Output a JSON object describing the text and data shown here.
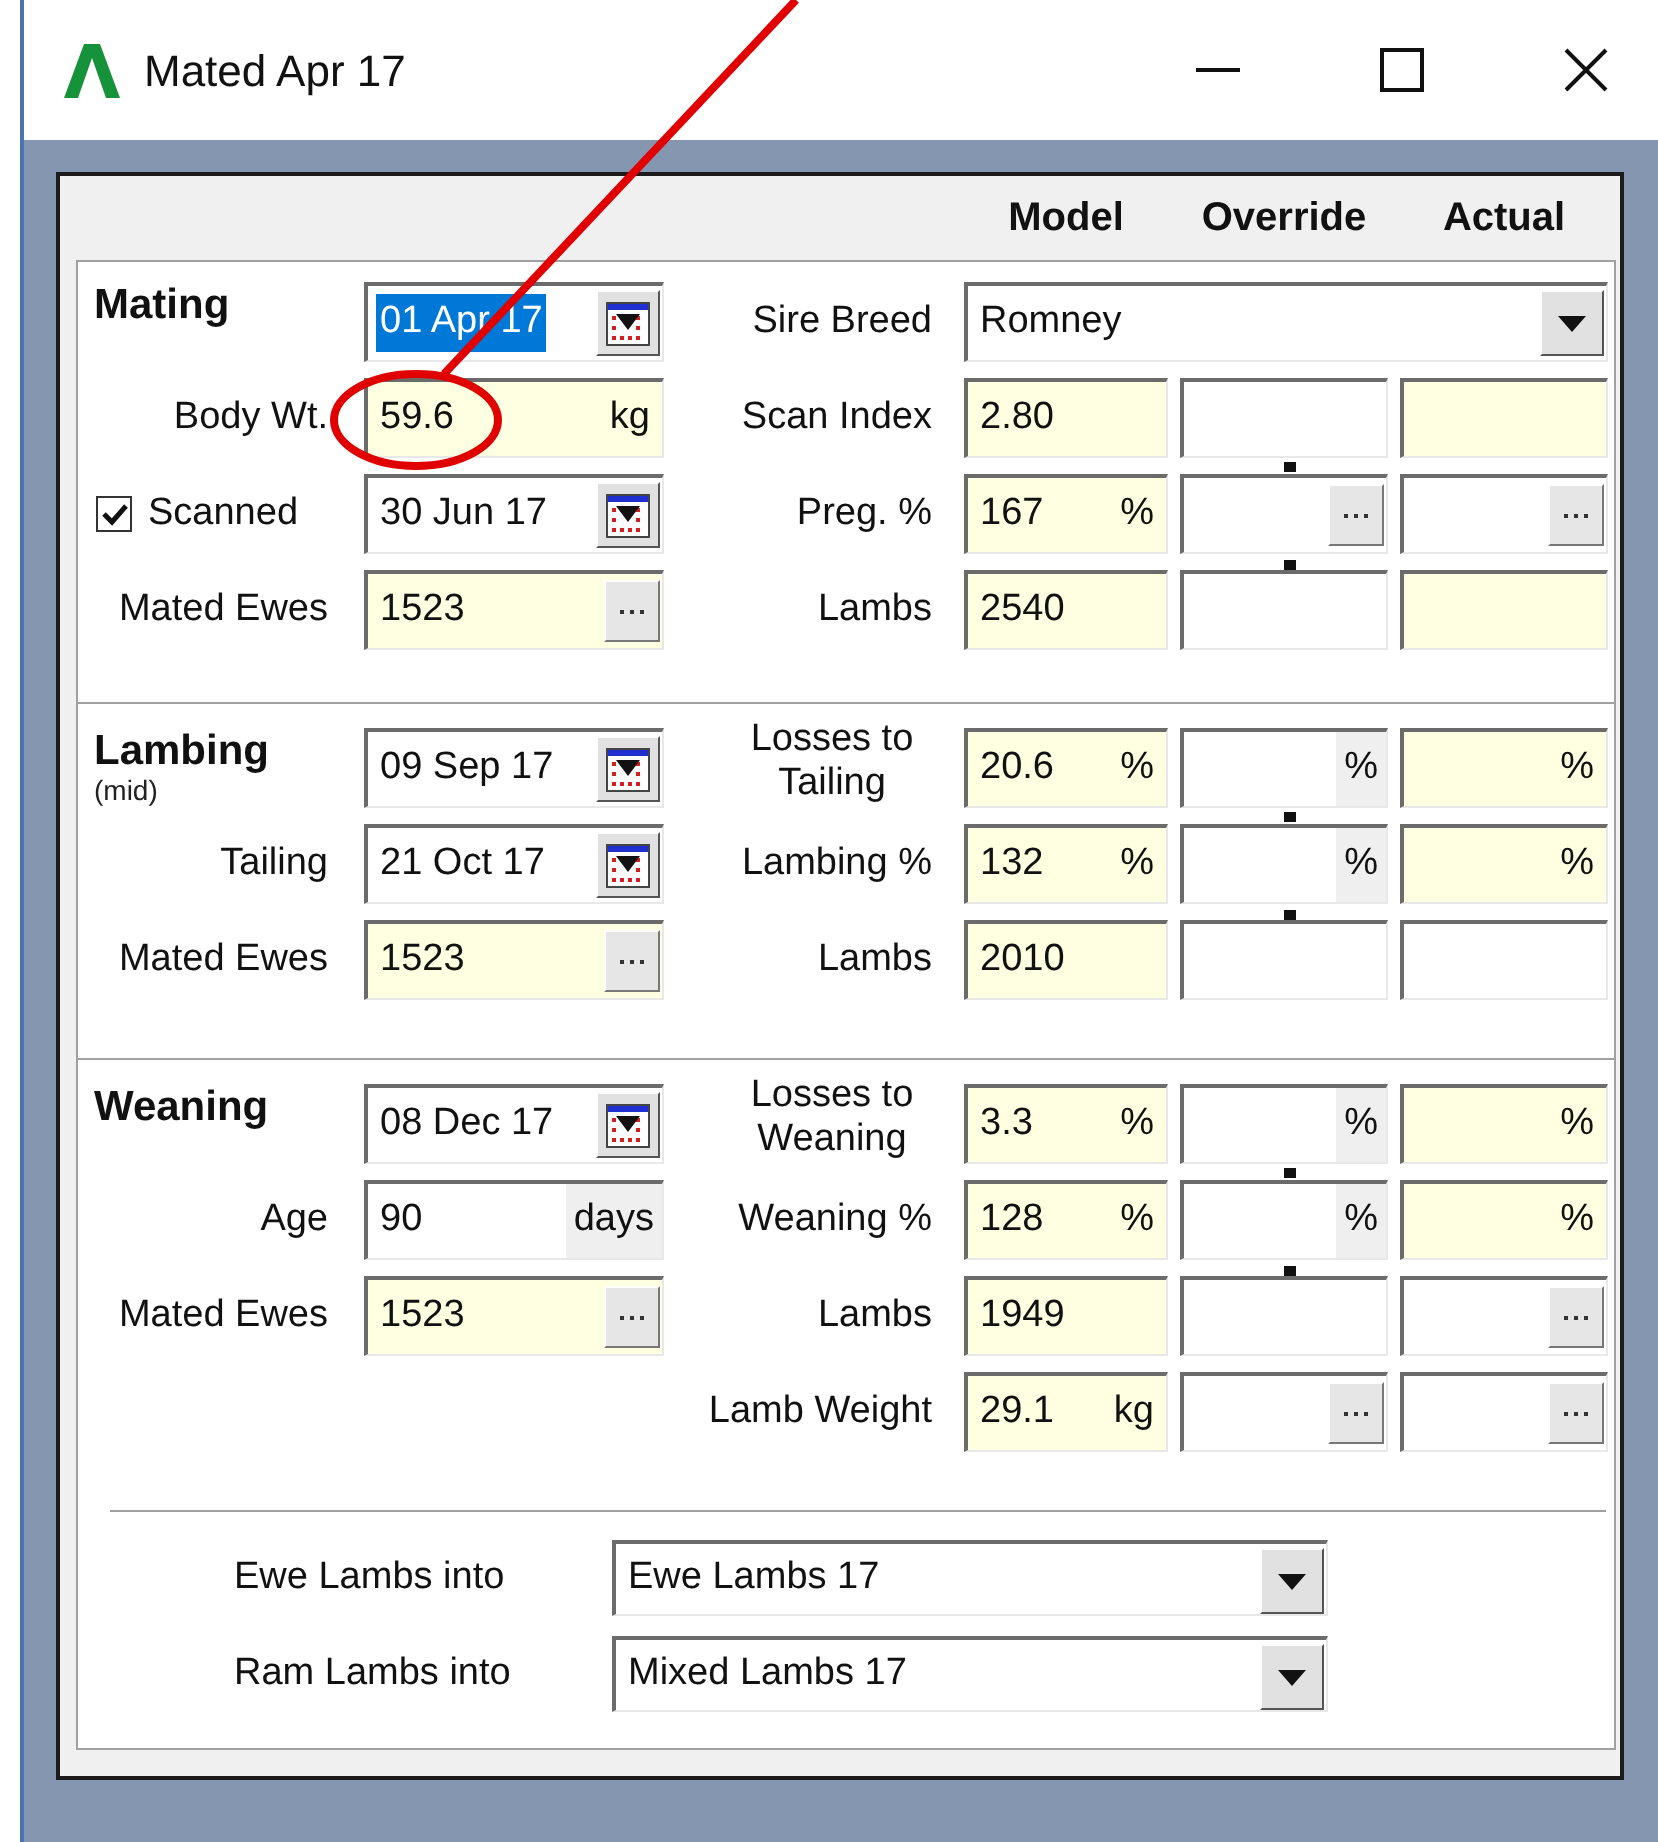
{
  "window": {
    "title": "Mated Apr 17"
  },
  "columns": [
    "Model",
    "Override",
    "Actual"
  ],
  "sections": [
    {
      "rows": [
        {
          "left": {
            "kind": "heading",
            "text": "Mating"
          },
          "field": {
            "kind": "date",
            "value": "01 Apr 17",
            "selected": true
          },
          "label2": "Sire Breed",
          "combo": {
            "value": "Romney"
          }
        },
        {
          "left": {
            "kind": "text",
            "text": "Body Wt."
          },
          "field": {
            "kind": "unit",
            "value": "59.6",
            "unit": "kg",
            "shaded": true
          },
          "label2": "Scan Index",
          "model": {
            "value": "2.80",
            "shaded": true
          },
          "override": {
            "shaded": false
          },
          "actual": {
            "shaded": true
          }
        },
        {
          "left": {
            "kind": "checkbox",
            "text": "Scanned",
            "checked": true
          },
          "field": {
            "kind": "date",
            "value": "30 Jun 17",
            "selected": false
          },
          "label2": "Preg. %",
          "model": {
            "value": "167",
            "unit": "%",
            "shaded": true
          },
          "override": {
            "shaded": false,
            "button": true,
            "linked": true
          },
          "actual": {
            "shaded": false,
            "button": true
          }
        },
        {
          "left": {
            "kind": "text",
            "text": "Mated Ewes"
          },
          "field": {
            "kind": "picker",
            "value": "1523",
            "shaded": true
          },
          "label2": "Lambs",
          "model": {
            "value": "2540",
            "shaded": true
          },
          "override": {
            "shaded": false
          },
          "actual": {
            "shaded": true
          }
        }
      ]
    },
    {
      "rows": [
        {
          "left": {
            "kind": "heading",
            "text": "Lambing",
            "note": "(mid)"
          },
          "field": {
            "kind": "date",
            "value": "09 Sep 17",
            "selected": false
          },
          "label2": "Losses to Tailing",
          "model": {
            "value": "20.6",
            "unit": "%",
            "shaded": true
          },
          "override": {
            "shaded": false,
            "unit": "%"
          },
          "actual": {
            "shaded": true,
            "unit": "%"
          }
        },
        {
          "left": {
            "kind": "text",
            "text": "Tailing"
          },
          "field": {
            "kind": "date",
            "value": "21 Oct 17",
            "selected": false
          },
          "label2": "Lambing %",
          "model": {
            "value": "132",
            "unit": "%",
            "shaded": true
          },
          "override": {
            "shaded": false,
            "unit": "%",
            "linked": true
          },
          "actual": {
            "shaded": true,
            "unit": "%"
          }
        },
        {
          "left": {
            "kind": "text",
            "text": "Mated Ewes"
          },
          "field": {
            "kind": "picker",
            "value": "1523",
            "shaded": true
          },
          "label2": "Lambs",
          "model": {
            "value": "2010",
            "shaded": true
          },
          "override": {
            "shaded": false
          },
          "actual": {
            "shaded": false
          }
        }
      ]
    },
    {
      "rows": [
        {
          "left": {
            "kind": "heading",
            "text": "Weaning"
          },
          "field": {
            "kind": "date",
            "value": "08 Dec 17",
            "selected": false
          },
          "label2": "Losses to Weaning",
          "model": {
            "value": "3.3",
            "unit": "%",
            "shaded": true
          },
          "override": {
            "shaded": false,
            "unit": "%"
          },
          "actual": {
            "shaded": true,
            "unit": "%"
          }
        },
        {
          "left": {
            "kind": "text",
            "text": "Age"
          },
          "field": {
            "kind": "unit",
            "value": "90",
            "unit": "days",
            "shaded": false
          },
          "label2": "Weaning %",
          "model": {
            "value": "128",
            "unit": "%",
            "shaded": true
          },
          "override": {
            "shaded": false,
            "unit": "%",
            "linked": true
          },
          "actual": {
            "shaded": true,
            "unit": "%"
          }
        },
        {
          "left": {
            "kind": "text",
            "text": "Mated Ewes"
          },
          "field": {
            "kind": "picker",
            "value": "1523",
            "shaded": true
          },
          "label2": "Lambs",
          "model": {
            "value": "1949",
            "shaded": true
          },
          "override": {
            "shaded": false
          },
          "actual": {
            "shaded": false,
            "button": true
          }
        },
        {
          "label2": "Lamb Weight",
          "model": {
            "value": "29.1",
            "unit": "kg",
            "shaded": true
          },
          "override": {
            "shaded": false,
            "button": true
          },
          "actual": {
            "shaded": false,
            "button": true
          }
        }
      ]
    }
  ],
  "destinations": [
    {
      "label": "Ewe Lambs into",
      "value": "Ewe Lambs 17"
    },
    {
      "label": "Ram Lambs into",
      "value": "Mixed Lambs 17"
    }
  ],
  "annotation": {
    "kind": "circled"
  }
}
